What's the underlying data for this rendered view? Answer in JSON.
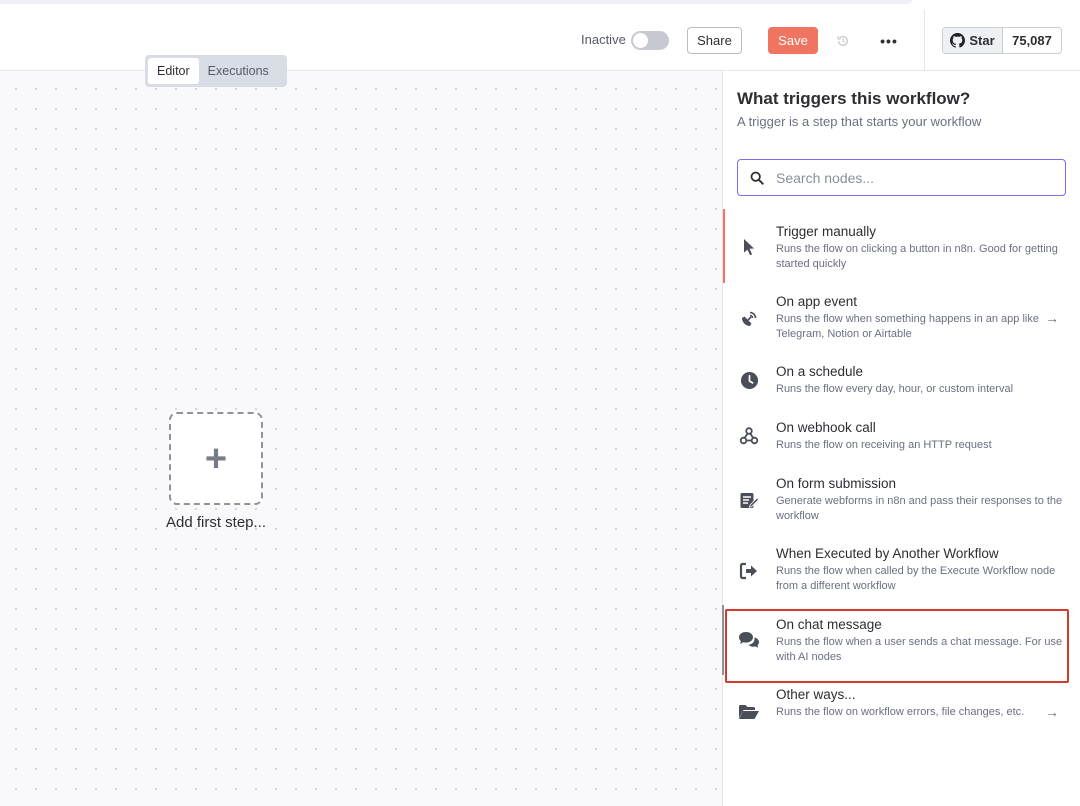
{
  "header": {
    "active_label": "Inactive",
    "share_label": "Share",
    "save_label": "Save",
    "more_label": "•••",
    "github": {
      "star_label": "Star",
      "count": "75,087"
    }
  },
  "canvas": {
    "tabs": [
      {
        "label": "Editor"
      },
      {
        "label": "Executions"
      }
    ],
    "add_step_label": "Add first step..."
  },
  "panel": {
    "title": "What triggers this workflow?",
    "subtitle": "A trigger is a step that starts your workflow",
    "search_placeholder": "Search nodes...",
    "items": [
      {
        "name": "Trigger manually",
        "desc": "Runs the flow on clicking a button in n8n. Good for getting started quickly",
        "icon": "cursor-icon"
      },
      {
        "name": "On app event",
        "desc": "Runs the flow when something happens in an app like Telegram, Notion or Airtable",
        "icon": "satellite-icon"
      },
      {
        "name": "On a schedule",
        "desc": "Runs the flow every day, hour, or custom interval",
        "icon": "clock-icon"
      },
      {
        "name": "On webhook call",
        "desc": "Runs the flow on receiving an HTTP request",
        "icon": "webhook-icon"
      },
      {
        "name": "On form submission",
        "desc": "Generate webforms in n8n and pass their responses to the workflow",
        "icon": "form-icon"
      },
      {
        "name": "When Executed by Another Workflow",
        "desc": "Runs the flow when called by the Execute Workflow node from a different workflow",
        "icon": "sign-in-icon"
      },
      {
        "name": "On chat message",
        "desc": "Runs the flow when a user sends a chat message. For use with AI nodes",
        "icon": "chat-icon"
      },
      {
        "name": "Other ways...",
        "desc": "Runs the flow on workflow errors, file changes, etc.",
        "icon": "folder-open-icon"
      }
    ]
  },
  "colors": {
    "accent": "#ef7560",
    "search_border": "#7a6cf4",
    "highlight": "#d33a2c"
  }
}
